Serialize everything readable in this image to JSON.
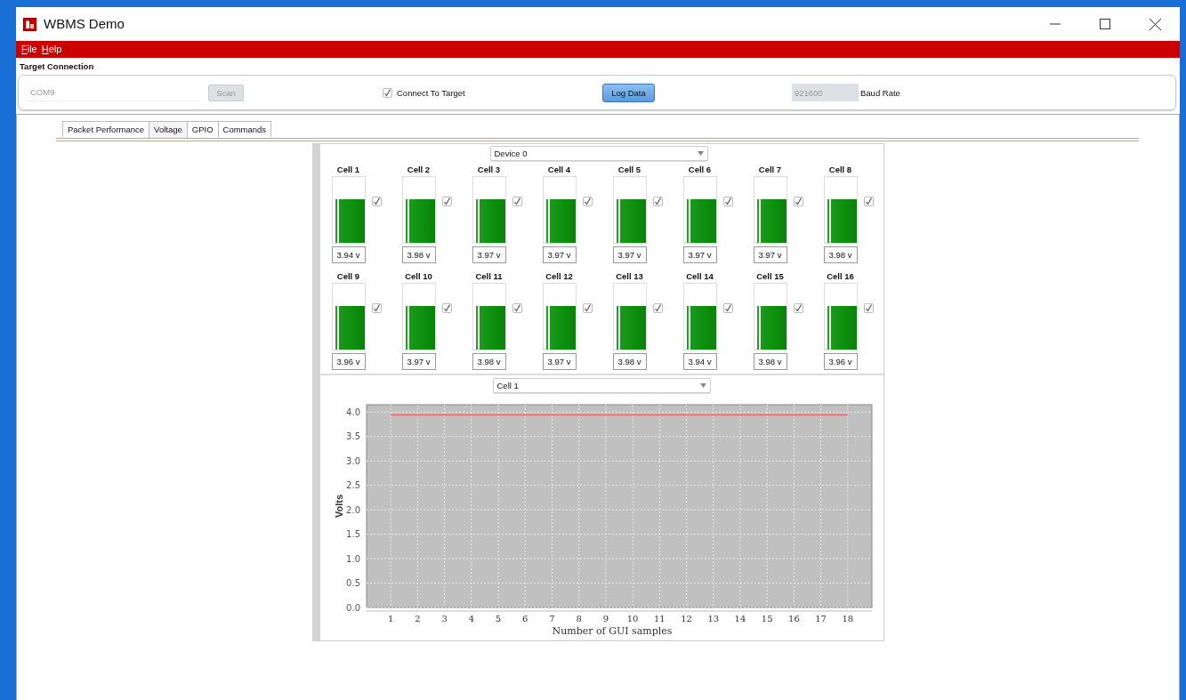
{
  "window": {
    "title": "WBMS Demo"
  },
  "menu": [
    {
      "label": "File"
    },
    {
      "label": "Help"
    }
  ],
  "connection": {
    "title": "Target Connection",
    "port": {
      "value": "COM9",
      "disabled": true
    },
    "scan_button": {
      "label": "Scan",
      "disabled": true
    },
    "connect": {
      "label": "Connect To Target",
      "checked": true
    },
    "log_button": {
      "label": "Log Data"
    },
    "baud": {
      "value": "921600",
      "disabled": true
    },
    "baud_label": "Baud Rate"
  },
  "tabs": [
    {
      "label": "Packet Performance",
      "selected": false
    },
    {
      "label": "Voltage",
      "selected": true
    },
    {
      "label": "GPIO",
      "selected": false
    },
    {
      "label": "Commands",
      "selected": false
    }
  ],
  "voltage": {
    "device_select": {
      "value": "Device 0"
    },
    "cells": [
      {
        "label": "Cell 1",
        "level": 0.67,
        "checked": true,
        "reading": "3.94 v"
      },
      {
        "label": "Cell 2",
        "level": 0.67,
        "checked": true,
        "reading": "3.98 v"
      },
      {
        "label": "Cell 3",
        "level": 0.67,
        "checked": true,
        "reading": "3.97 v"
      },
      {
        "label": "Cell 4",
        "level": 0.67,
        "checked": true,
        "reading": "3.97 v"
      },
      {
        "label": "Cell 5",
        "level": 0.67,
        "checked": true,
        "reading": "3.97 v"
      },
      {
        "label": "Cell 6",
        "level": 0.67,
        "checked": true,
        "reading": "3.97 v"
      },
      {
        "label": "Cell 7",
        "level": 0.67,
        "checked": true,
        "reading": "3.97 v"
      },
      {
        "label": "Cell 8",
        "level": 0.67,
        "checked": true,
        "reading": "3.98 v"
      },
      {
        "label": "Cell 9",
        "level": 0.67,
        "checked": true,
        "reading": "3.96 v"
      },
      {
        "label": "Cell 10",
        "level": 0.67,
        "checked": true,
        "reading": "3.97 v"
      },
      {
        "label": "Cell 11",
        "level": 0.67,
        "checked": true,
        "reading": "3.98 v"
      },
      {
        "label": "Cell 12",
        "level": 0.67,
        "checked": true,
        "reading": "3.97 v"
      },
      {
        "label": "Cell 13",
        "level": 0.67,
        "checked": true,
        "reading": "3.98 v"
      },
      {
        "label": "Cell 14",
        "level": 0.66,
        "checked": true,
        "reading": "3.94 v"
      },
      {
        "label": "Cell 15",
        "level": 0.67,
        "checked": true,
        "reading": "3.98 v"
      },
      {
        "label": "Cell 16",
        "level": 0.67,
        "checked": true,
        "reading": "3.96 v"
      }
    ],
    "chart_select": {
      "value": "Cell 1"
    },
    "chart": {
      "chart_data": {
        "type": "line",
        "grid": true,
        "xlabel": "Number of GUI samples",
        "ylabel": "Volts",
        "x": [
          1,
          2,
          3,
          4,
          5,
          6,
          7,
          8,
          9,
          10,
          11,
          12,
          13,
          14,
          15,
          16,
          17,
          18
        ],
        "series": [
          {
            "color": "#e86a6a",
            "values": [
              3.94,
              3.94,
              3.94,
              3.94,
              3.94,
              3.94,
              3.94,
              3.94,
              3.94,
              3.94,
              3.94,
              3.94,
              3.94,
              3.94,
              3.94,
              3.94,
              3.94,
              3.94
            ]
          }
        ],
        "xlim": [
          0.1,
          18.9
        ],
        "ylim": [
          0,
          4.15
        ],
        "xticks": [
          1,
          2,
          3,
          4,
          5,
          6,
          7,
          8,
          9,
          10,
          11,
          12,
          13,
          14,
          15,
          16,
          17,
          18
        ],
        "yticks": [
          {
            "value": 0,
            "label": "0.0"
          },
          {
            "value": 0.5,
            "label": "0.5"
          },
          {
            "value": 1,
            "label": "1.0"
          },
          {
            "value": 1.5,
            "label": "1.5"
          },
          {
            "value": 2,
            "label": "2.0"
          },
          {
            "value": 2.5,
            "label": "2.5"
          },
          {
            "value": 3,
            "label": "3.0"
          },
          {
            "value": 3.5,
            "label": "3.5"
          },
          {
            "value": 4,
            "label": "4.0"
          }
        ]
      }
    }
  }
}
